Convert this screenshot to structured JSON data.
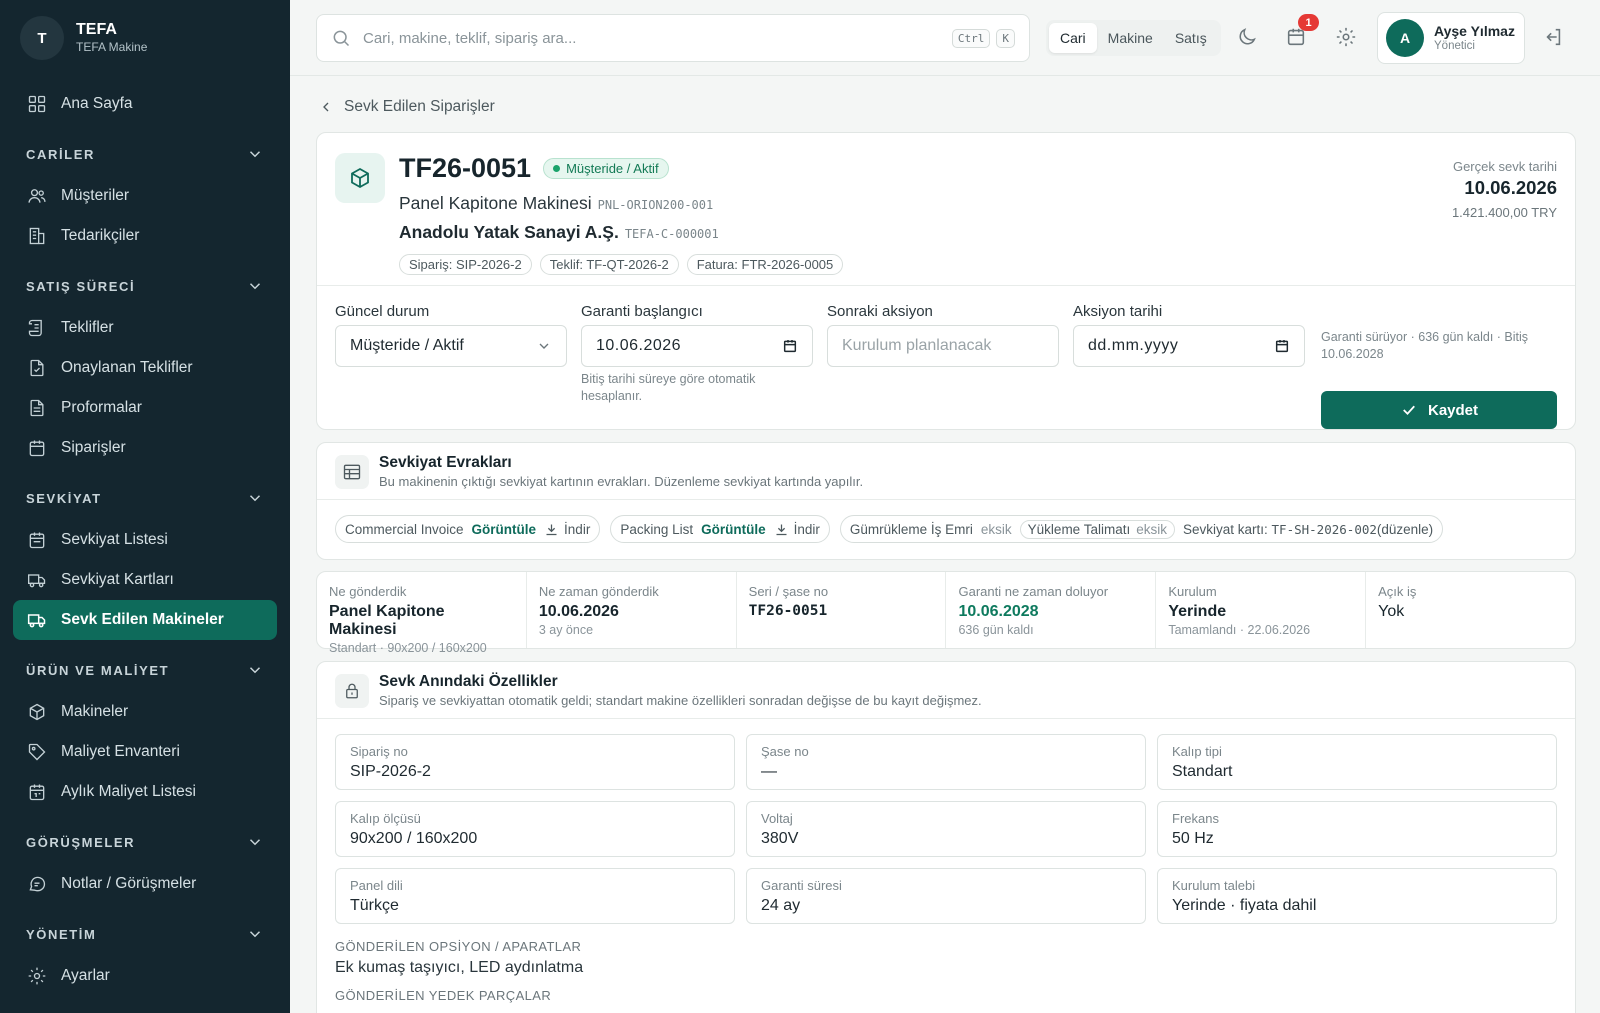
{
  "brand": {
    "initial": "T",
    "name": "TEFA",
    "sub": "TEFA Makine"
  },
  "nav": {
    "home": "Ana Sayfa",
    "s1": "CARİLER",
    "musteriler": "Müşteriler",
    "tedarikciler": "Tedarikçiler",
    "s2": "SATIŞ SÜRECİ",
    "teklifler": "Teklifler",
    "onaylanan": "Onaylanan Teklifler",
    "proformalar": "Proformalar",
    "siparisler": "Siparişler",
    "s3": "SEVKİYAT",
    "sevkiyat_listesi": "Sevkiyat Listesi",
    "sevkiyat_kartlari": "Sevkiyat Kartları",
    "sevk_edilen": "Sevk Edilen Makineler",
    "s4": "ÜRÜN VE MALİYET",
    "makineler": "Makineler",
    "maliyet_envanteri": "Maliyet Envanteri",
    "aylik_maliyet": "Aylık Maliyet Listesi",
    "s5": "GÖRÜŞMELER",
    "notlar": "Notlar / Görüşmeler",
    "s6": "YÖNETİM",
    "ayarlar": "Ayarlar"
  },
  "topbar": {
    "search_placeholder": "Cari, makine, teklif, sipariş ara...",
    "kbd1": "Ctrl",
    "kbd2": "K",
    "quick": [
      "Cari",
      "Makine",
      "Satış"
    ],
    "notif_count": "1",
    "user": {
      "initial": "A",
      "name": "Ayşe Yılmaz",
      "role": "Yönetici"
    }
  },
  "back_label": "Sevk Edilen Siparişler",
  "header": {
    "no": "TF26-0051",
    "status": "Müşteride / Aktif",
    "machine": "Panel Kapitone Makinesi",
    "machine_code": "PNL-ORION200-001",
    "customer": "Anadolu Yatak Sanayi A.Ş.",
    "customer_code": "TEFA-C-000001",
    "refs": [
      "Sipariş: SIP-2026-2",
      "Teklif: TF-QT-2026-2",
      "Fatura: FTR-2026-0005"
    ],
    "ship_date_label": "Gerçek sevk tarihi",
    "ship_date": "10.06.2026",
    "amount": "1.421.400,00 TRY"
  },
  "form": {
    "status_label": "Güncel durum",
    "status_value": "Müşteride / Aktif",
    "warranty_label": "Garanti başlangıcı",
    "warranty_value": "10.06.2026",
    "warranty_hint": "Bitiş tarihi süreye göre otomatik hesaplanır.",
    "next_label": "Sonraki aksiyon",
    "next_placeholder": "Kurulum planlanacak",
    "action_date_label": "Aksiyon tarihi",
    "action_date_placeholder": "dd.mm.yyyy",
    "right_hint": "Garanti sürüyor · 636 gün kaldı · Bitiş 10.06.2028",
    "save": "Kaydet"
  },
  "docs": {
    "title": "Sevkiyat Evrakları",
    "subtitle": "Bu makinenin çıktığı sevkiyat kartının evrakları. Düzenleme sevkiyat kartında yapılır.",
    "view": "Görüntüle",
    "download": "İndir",
    "missing": "eksik",
    "ci": "Commercial Invoice",
    "pl": "Packing List",
    "gie": "Gümrükleme İş Emri",
    "yt": "Yükleme Talimatı",
    "card_label": "Sevkiyat kartı:",
    "card_code": "TF-SH-2026-002",
    "card_edit": "(düzenle)"
  },
  "stats": [
    {
      "label": "Ne gönderdik",
      "value": "Panel Kapitone Makinesi",
      "sub": "Standart · 90x200 / 160x200"
    },
    {
      "label": "Ne zaman gönderdik",
      "value": "10.06.2026",
      "sub": "3 ay önce"
    },
    {
      "label": "Seri / şase no",
      "value": "TF26-0051",
      "sub": ""
    },
    {
      "label": "Garanti ne zaman doluyor",
      "value": "10.06.2028",
      "sub": "636 gün kaldı"
    },
    {
      "label": "Kurulum",
      "value": "Yerinde",
      "sub": "Tamamlandı · 22.06.2026"
    },
    {
      "label": "Açık iş",
      "value": "Yok",
      "sub": ""
    }
  ],
  "specs": {
    "title": "Sevk Anındaki Özellikler",
    "subtitle": "Sipariş ve sevkiyattan otomatik geldi; standart makine özellikleri sonradan değişse de bu kayıt değişmez.",
    "items": [
      {
        "label": "Sipariş no",
        "value": "SIP-2026-2"
      },
      {
        "label": "Şase no",
        "value": "—"
      },
      {
        "label": "Kalıp tipi",
        "value": "Standart"
      },
      {
        "label": "Kalıp ölçüsü",
        "value": "90x200 / 160x200"
      },
      {
        "label": "Voltaj",
        "value": "380V"
      },
      {
        "label": "Frekans",
        "value": "50 Hz"
      },
      {
        "label": "Panel dili",
        "value": "Türkçe"
      },
      {
        "label": "Garanti süresi",
        "value": "24 ay"
      },
      {
        "label": "Kurulum talebi",
        "value": "Yerinde · fiyata dahil"
      }
    ],
    "options_label": "GÖNDERİLEN OPSİYON / APARATLAR",
    "options_value": "Ek kumaş taşıyıcı, LED aydınlatma",
    "spares_label": "GÖNDERİLEN YEDEK PARÇALAR"
  }
}
